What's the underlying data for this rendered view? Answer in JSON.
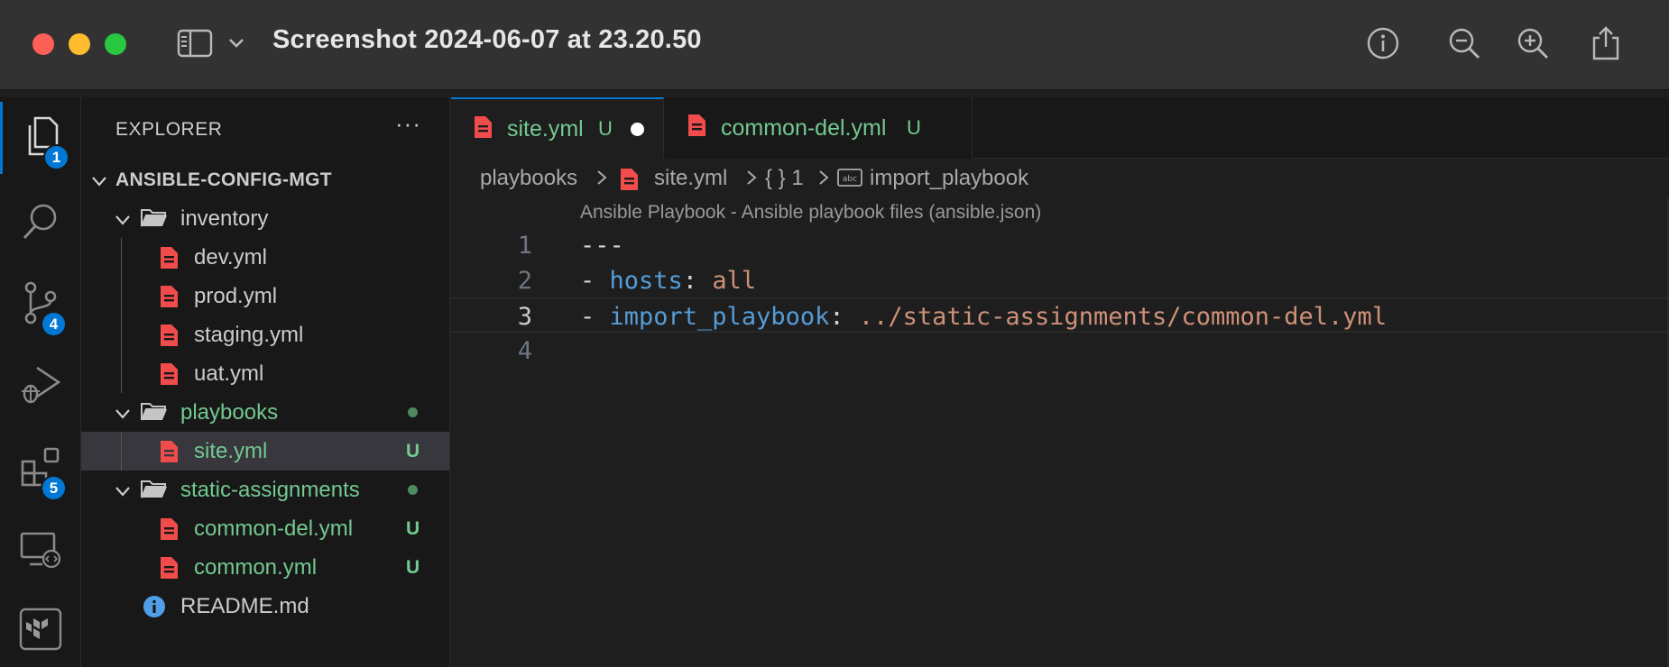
{
  "window": {
    "title": "Screenshot 2024-06-07 at 23.20.50"
  },
  "activity_bar": {
    "items": [
      {
        "name": "explorer",
        "badge": "1"
      },
      {
        "name": "search",
        "badge": ""
      },
      {
        "name": "source-control",
        "badge": "4"
      },
      {
        "name": "run-debug",
        "badge": ""
      },
      {
        "name": "extensions",
        "badge": "5"
      },
      {
        "name": "remote-explorer",
        "badge": ""
      },
      {
        "name": "terraform",
        "badge": ""
      }
    ]
  },
  "sidebar": {
    "header": "EXPLORER",
    "more": "···",
    "root": "ANSIBLE-CONFIG-MGT",
    "tree": [
      {
        "label": "inventory",
        "kind": "folder"
      },
      {
        "label": "dev.yml",
        "kind": "file"
      },
      {
        "label": "prod.yml",
        "kind": "file"
      },
      {
        "label": "staging.yml",
        "kind": "file"
      },
      {
        "label": "uat.yml",
        "kind": "file"
      },
      {
        "label": "playbooks",
        "kind": "folder"
      },
      {
        "label": "site.yml",
        "kind": "file",
        "git": "U"
      },
      {
        "label": "static-assignments",
        "kind": "folder"
      },
      {
        "label": "common-del.yml",
        "kind": "file",
        "git": "U"
      },
      {
        "label": "common.yml",
        "kind": "file",
        "git": "U"
      },
      {
        "label": "README.md",
        "kind": "info"
      }
    ]
  },
  "tabs": [
    {
      "label": "site.yml",
      "status": "U",
      "active": true,
      "dirty": true
    },
    {
      "label": "common-del.yml",
      "status": "U",
      "active": false,
      "dirty": false
    }
  ],
  "breadcrumb": {
    "folder": "playbooks",
    "file": "site.yml",
    "section": "{ } 1",
    "symbol": "import_playbook"
  },
  "editor": {
    "codelens": "Ansible Playbook - Ansible playbook files (ansible.json)",
    "line_numbers": [
      "1",
      "2",
      "3",
      "4"
    ],
    "line1": "---",
    "line2_dash": "- ",
    "line2_key": "hosts",
    "line2_colon": ": ",
    "line2_value": "all",
    "line3_dash": "- ",
    "line3_key": "import_playbook",
    "line3_colon": ": ",
    "line3_value": "../static-assignments/common-del.yml",
    "active_line": "3"
  },
  "colors": {
    "accent": "#0078d4",
    "git_untracked": "#73c991",
    "yaml_file_icon": "#f14c4c",
    "key": "#569cd6",
    "string": "#ce9178"
  }
}
